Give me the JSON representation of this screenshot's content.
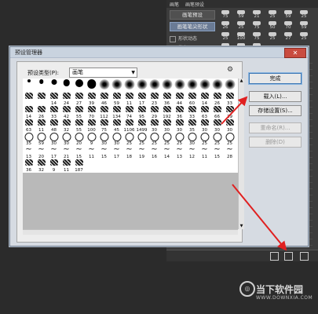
{
  "ps_panel": {
    "tabs": [
      "画笔",
      "画笔预设"
    ],
    "buttons": [
      "画笔预设",
      "画笔笔尖形状"
    ],
    "options": [
      "形状动态",
      "散布"
    ],
    "grid_numbers": [
      "75",
      "59",
      "21",
      "25",
      "59",
      "25",
      "26",
      "25",
      "75",
      "50",
      "70",
      "59",
      "25",
      "100",
      "75",
      "25",
      "27",
      "25",
      "50",
      "75",
      "75"
    ]
  },
  "dialog": {
    "title": "预设管理器",
    "close_label": "✕",
    "type_label": "预设类型(P):",
    "type_value": "画笔",
    "gear": "⚙",
    "buttons": {
      "done": "完成",
      "load": "载入(L)...",
      "save": "存储设置(S)...",
      "rename": "重命名(R)...",
      "delete": "删除(D)"
    },
    "brushes": [
      {
        "n": "1",
        "m": "dot"
      },
      {
        "n": "3",
        "m": "dot"
      },
      {
        "n": "5",
        "m": "dot"
      },
      {
        "n": "9",
        "m": "dot"
      },
      {
        "n": "13",
        "m": "dot"
      },
      {
        "n": "19",
        "m": "dot"
      },
      {
        "n": "5",
        "m": "soft"
      },
      {
        "n": "9",
        "m": "soft"
      },
      {
        "n": "13",
        "m": "soft"
      },
      {
        "n": "17",
        "m": "soft"
      },
      {
        "n": "21",
        "m": "soft"
      },
      {
        "n": "27",
        "m": "soft"
      },
      {
        "n": "35",
        "m": "soft"
      },
      {
        "n": "45",
        "m": "soft"
      },
      {
        "n": "65",
        "m": "soft"
      },
      {
        "n": "100",
        "m": "soft"
      },
      {
        "n": "200",
        "m": "soft"
      },
      {
        "n": "300",
        "m": "soft"
      },
      {
        "n": "9",
        "m": "dot"
      },
      {
        "n": "14",
        "m": "splat"
      },
      {
        "n": "26",
        "m": "splat"
      },
      {
        "n": "33",
        "m": "splat"
      },
      {
        "n": "42",
        "m": "splat"
      },
      {
        "n": "55",
        "m": "splat"
      },
      {
        "n": "70",
        "m": "splat"
      },
      {
        "n": "112",
        "m": "splat"
      },
      {
        "n": "134",
        "m": "splat"
      },
      {
        "n": "74",
        "m": "splat"
      },
      {
        "n": "95",
        "m": "splat"
      },
      {
        "n": "29",
        "m": "star"
      },
      {
        "n": "192",
        "m": "splat"
      },
      {
        "n": "36",
        "m": "splat"
      },
      {
        "n": "33",
        "m": "splat"
      },
      {
        "n": "63",
        "m": "splat"
      },
      {
        "n": "66",
        "m": "splat"
      },
      {
        "n": "39",
        "m": "splat"
      },
      {
        "n": "63",
        "m": "splat"
      },
      {
        "n": "11",
        "m": "splat"
      },
      {
        "n": "48",
        "m": "splat"
      },
      {
        "n": "32",
        "m": "splat"
      },
      {
        "n": "55",
        "m": "splat"
      },
      {
        "n": "100",
        "m": "splat"
      },
      {
        "n": "75",
        "m": "splat"
      },
      {
        "n": "45",
        "m": "splat"
      },
      {
        "n": "1106",
        "m": "splat"
      },
      {
        "n": "1499",
        "m": "splat"
      },
      {
        "n": "30",
        "m": "ring"
      },
      {
        "n": "30",
        "m": "ring"
      },
      {
        "n": "30",
        "m": "ring"
      },
      {
        "n": "35",
        "m": "ring"
      },
      {
        "n": "30",
        "m": "ring"
      },
      {
        "n": "30",
        "m": "ring"
      },
      {
        "n": "20",
        "m": "cross"
      },
      {
        "n": "9",
        "m": "cross"
      },
      {
        "n": "30",
        "m": "cross"
      },
      {
        "n": "30",
        "m": "ring"
      },
      {
        "n": "30",
        "m": "ring"
      },
      {
        "n": "30",
        "m": "cross"
      },
      {
        "n": "30",
        "m": "wave"
      },
      {
        "n": "30",
        "m": "wave"
      },
      {
        "n": "30",
        "m": "wave"
      },
      {
        "n": "30",
        "m": "ring"
      },
      {
        "n": "30",
        "m": "ring"
      },
      {
        "n": "20",
        "m": "splat"
      },
      {
        "n": "25",
        "m": "wave"
      },
      {
        "n": "25",
        "m": "splat"
      },
      {
        "n": "25",
        "m": "splat"
      },
      {
        "n": "25",
        "m": "wave"
      },
      {
        "n": "25",
        "m": "star"
      },
      {
        "n": "50",
        "m": "splat"
      },
      {
        "n": "71",
        "m": "splat"
      },
      {
        "n": "25",
        "m": "star"
      },
      {
        "n": "50",
        "m": "splat"
      },
      {
        "n": "50",
        "m": "splat"
      },
      {
        "n": "36",
        "m": "splat"
      },
      {
        "n": "30",
        "m": "splat"
      },
      {
        "n": "30",
        "m": "wave"
      },
      {
        "n": "30",
        "m": "wave"
      },
      {
        "n": "30",
        "m": "wave"
      },
      {
        "n": "30",
        "m": "ring"
      },
      {
        "n": "30",
        "m": "ring"
      },
      {
        "n": "30",
        "m": "ring"
      },
      {
        "n": "14",
        "m": "splat"
      },
      {
        "n": "24",
        "m": "splat"
      },
      {
        "n": "27",
        "m": "splat"
      },
      {
        "n": "39",
        "m": "wave"
      },
      {
        "n": "46",
        "m": "wave"
      },
      {
        "n": "59",
        "m": "wave"
      },
      {
        "n": "11",
        "m": "splat"
      },
      {
        "n": "17",
        "m": "splat"
      },
      {
        "n": "23",
        "m": "splat"
      },
      {
        "n": "36",
        "m": "splat"
      },
      {
        "n": "44",
        "m": "splat"
      },
      {
        "n": "60",
        "m": "splat"
      },
      {
        "n": "14",
        "m": "wave"
      },
      {
        "n": "26",
        "m": "wave"
      },
      {
        "n": "33",
        "m": "wave"
      },
      {
        "n": "42",
        "m": "wave"
      },
      {
        "n": "55",
        "m": "wave"
      },
      {
        "n": "70",
        "m": "wave"
      }
    ],
    "rows_display": [
      [
        "",
        "",
        "",
        "",
        "",
        "",
        "",
        "",
        "",
        "",
        "",
        "",
        "",
        "",
        "",
        "",
        ""
      ],
      [
        "",
        "",
        "14",
        "24",
        "27",
        "39",
        "46",
        "59",
        "11",
        "17",
        "23",
        "36",
        "44",
        "60",
        "14",
        "26",
        "33"
      ],
      [
        "14",
        "26",
        "33",
        "42",
        "55",
        "70",
        "112",
        "134",
        "74",
        "95",
        "29",
        "192",
        "36",
        "33",
        "63",
        "66",
        "39"
      ],
      [
        "63",
        "11",
        "48",
        "32",
        "55",
        "100",
        "75",
        "45",
        "1106",
        "1499",
        "30",
        "30",
        "30",
        "35",
        "30",
        "30",
        "30"
      ],
      [
        "35",
        "59",
        "30",
        "30",
        "20",
        "9",
        "30",
        "30",
        "25",
        "25",
        "25",
        "25",
        "25",
        "30",
        "25",
        "25",
        "25"
      ],
      [
        "13",
        "20",
        "17",
        "21",
        "15",
        "11",
        "15",
        "17",
        "18",
        "19",
        "16",
        "14",
        "13",
        "12",
        "11",
        "15",
        "28"
      ],
      [
        "36",
        "32",
        "9",
        "11",
        "187",
        "",
        "",
        "",
        "",
        "",
        "",
        "",
        "",
        "",
        "",
        "",
        ""
      ]
    ]
  },
  "watermark": {
    "logo": "◎",
    "cn": "当下软件园",
    "url": "WWW.DOWNXIA.COM"
  },
  "colors": {
    "arrow": "#e02020",
    "dialog_bg": "#d6dbe2",
    "close_bg": "#c94c40"
  }
}
